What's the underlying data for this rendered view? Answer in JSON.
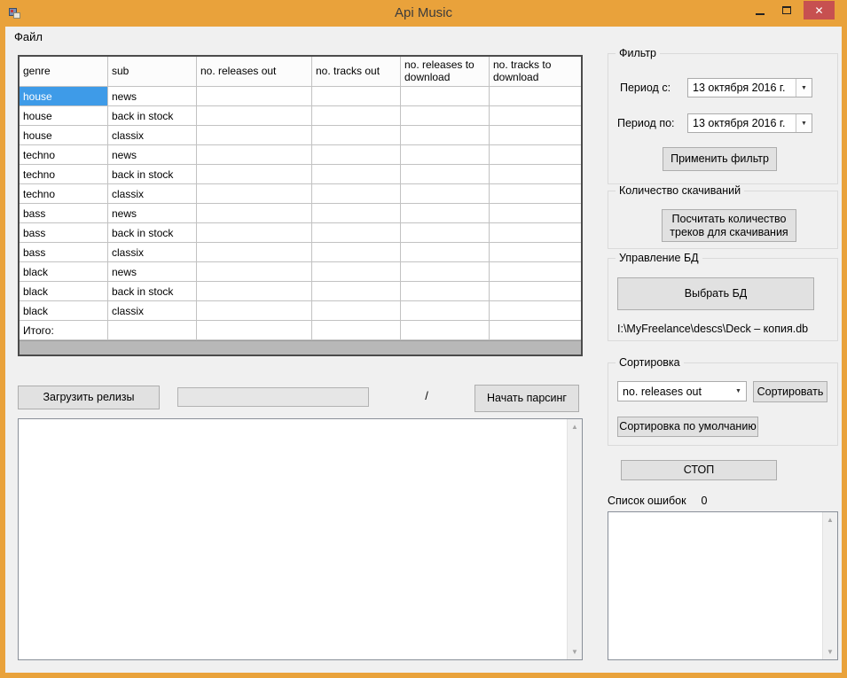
{
  "theme": {
    "titlebar_color": "#E9A23B",
    "close_button_color": "#C75050",
    "selection_color": "#3E9BE8"
  },
  "window": {
    "title": "Api Music",
    "minimize_glyph": "",
    "maximize_glyph": "",
    "close_glyph": "✕"
  },
  "menu": {
    "file": "Файл"
  },
  "grid": {
    "columns": [
      {
        "label": "genre"
      },
      {
        "label": "sub"
      },
      {
        "label": "no. releases out"
      },
      {
        "label": "no. tracks out"
      },
      {
        "label": "no. releases to download"
      },
      {
        "label": "no. tracks to download"
      }
    ],
    "rows": [
      {
        "genre": "house",
        "sub": "news"
      },
      {
        "genre": "house",
        "sub": "back in stock"
      },
      {
        "genre": "house",
        "sub": "classix"
      },
      {
        "genre": "techno",
        "sub": "news"
      },
      {
        "genre": "techno",
        "sub": "back in stock"
      },
      {
        "genre": "techno",
        "sub": "classix"
      },
      {
        "genre": "bass",
        "sub": "news"
      },
      {
        "genre": "bass",
        "sub": "back in stock"
      },
      {
        "genre": "bass",
        "sub": "classix"
      },
      {
        "genre": "black",
        "sub": "news"
      },
      {
        "genre": "black",
        "sub": "back in stock"
      },
      {
        "genre": "black",
        "sub": "classix"
      },
      {
        "genre": "Итого:",
        "sub": ""
      }
    ]
  },
  "actions": {
    "load_releases": "Загрузить релизы",
    "progress_separator": "/",
    "start_parsing": "Начать парсинг"
  },
  "filter": {
    "title": "Фильтр",
    "period_from_label": "Период с:",
    "period_from_value": "13 октября  2016 г.",
    "period_to_label": "Период по:",
    "period_to_value": "13 октября  2016 г.",
    "apply_button": "Применить фильтр"
  },
  "downloads": {
    "title": "Количество скачиваний",
    "count_button": "Посчитать количество треков для скачивания"
  },
  "db": {
    "title": "Управление БД",
    "select_button": "Выбрать БД",
    "path": "I:\\MyFreelance\\descs\\Deck – копия.db"
  },
  "sorting": {
    "title": "Сортировка",
    "combo_value": "no. releases out",
    "sort_button": "Сортировать",
    "default_button": "Сортировка по умолчанию"
  },
  "stop": {
    "label": "СТОП"
  },
  "errors": {
    "label": "Список ошибок",
    "count": "0"
  }
}
